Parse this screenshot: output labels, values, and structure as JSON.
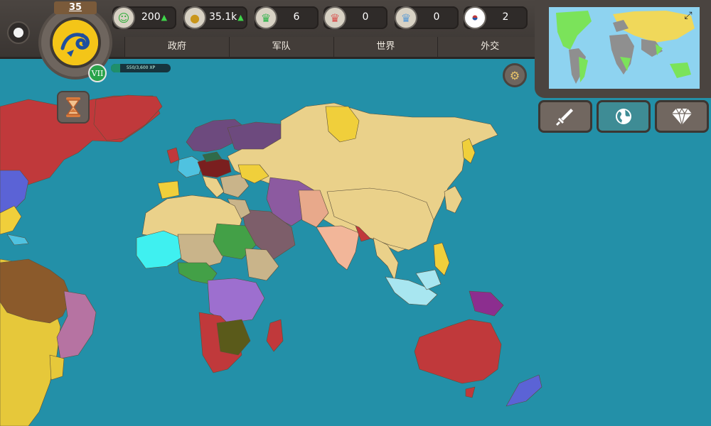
{
  "header": {
    "level": "35",
    "rank_numeral": "VII",
    "xp": {
      "text": "550/3,600 XP",
      "fraction": 0.15
    }
  },
  "stats": [
    {
      "icon": "happiness-icon",
      "value": "200",
      "trend": "up",
      "color": "#3bbf3e"
    },
    {
      "icon": "coins-icon",
      "value": "35.1k",
      "trend": "up",
      "color": "#e3b533"
    },
    {
      "icon": "green-crown-icon",
      "value": "6",
      "color": "#2fb34a"
    },
    {
      "icon": "red-crown-icon",
      "value": "0",
      "color": "#d9534f"
    },
    {
      "icon": "blue-crown-icon",
      "value": "0",
      "color": "#5b9bd5"
    },
    {
      "icon": "korea-flag-icon",
      "value": "2",
      "color": "#ffffff"
    }
  ],
  "tabs": [
    "政府",
    "军队",
    "世界",
    "外交"
  ],
  "action_buttons": [
    {
      "name": "sword-button",
      "icon": "sword-icon"
    },
    {
      "name": "world-button",
      "icon": "globe-icon"
    },
    {
      "name": "diamond-button",
      "icon": "diamond-icon"
    }
  ],
  "colors": {
    "ocean": "#2390a8",
    "player_yellow": "#f0cf3b",
    "neutral_tan": "#ead18a",
    "russia_purple": "#6d4a7e",
    "usa_red": "#c0393b"
  }
}
